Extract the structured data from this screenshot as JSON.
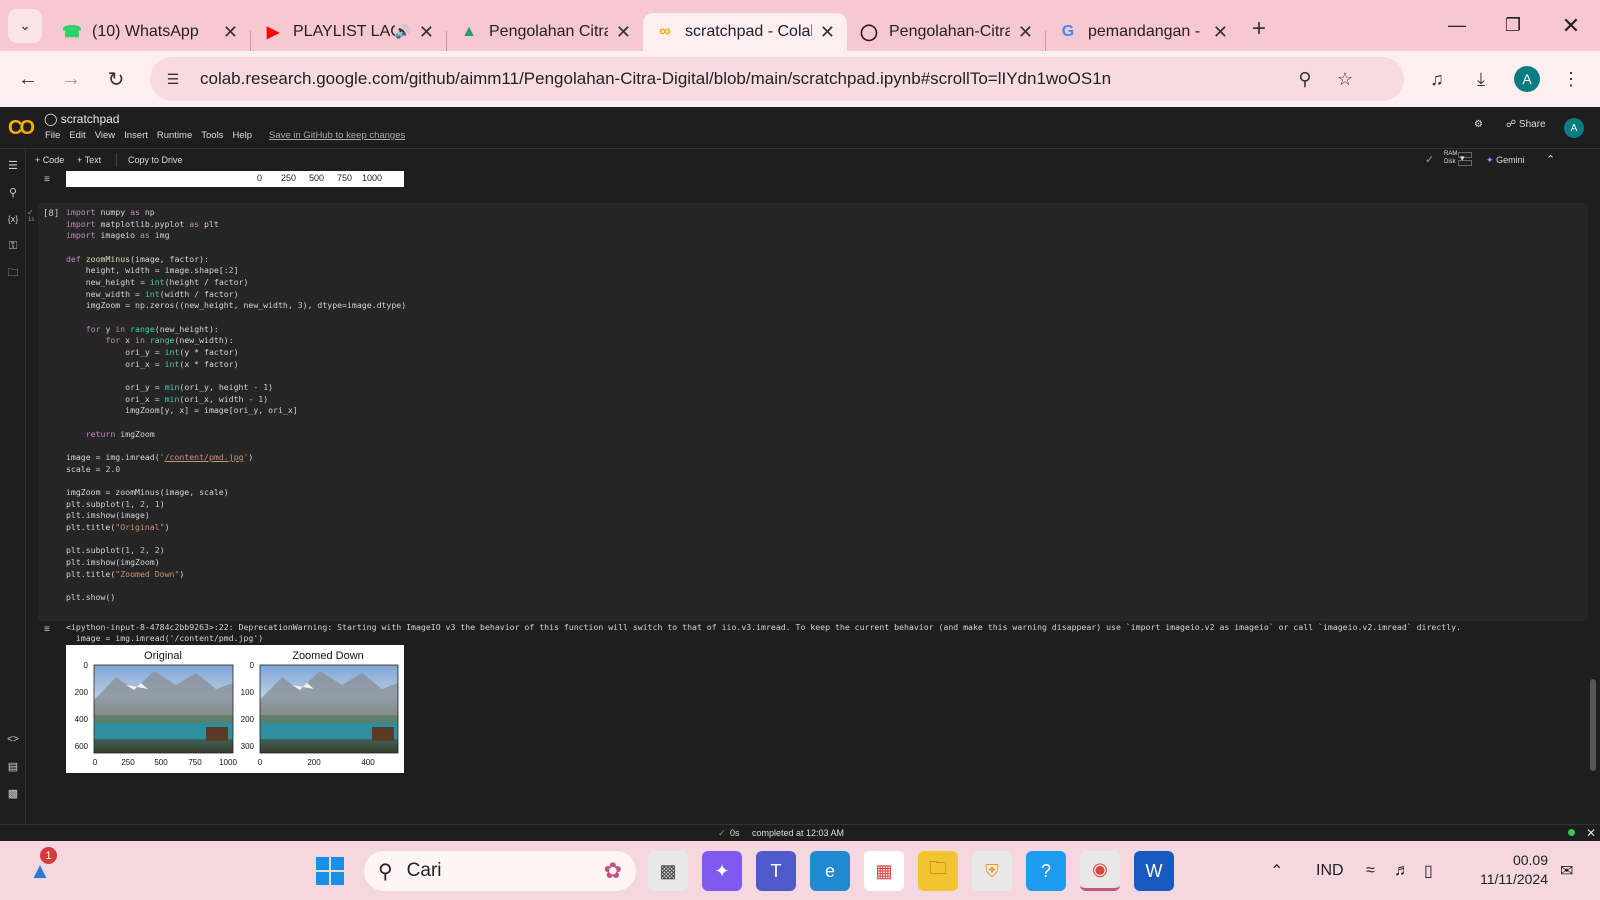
{
  "browser": {
    "tabs": [
      {
        "label": "(10) WhatsApp",
        "icon": "whatsapp-icon",
        "active": false
      },
      {
        "label": "PLAYLIST LAGU",
        "icon": "youtube-icon",
        "active": false,
        "audio": true
      },
      {
        "label": "Pengolahan Citra D",
        "icon": "google-drive-icon",
        "active": false
      },
      {
        "label": "scratchpad - Colab",
        "icon": "colab-icon",
        "active": true
      },
      {
        "label": "Pengolahan-Citra-D",
        "icon": "github-icon",
        "active": false
      },
      {
        "label": "pemandangan - Pe",
        "icon": "google-icon",
        "active": false
      }
    ],
    "url": "colab.research.google.com/github/aimm11/Pengolahan-Citra-Digital/blob/main/scratchpad.ipynb#scrollTo=lIYdn1woOS1n",
    "avatar_letter": "A"
  },
  "colab": {
    "notebook_title": "scratchpad",
    "menu": [
      "File",
      "Edit",
      "View",
      "Insert",
      "Runtime",
      "Tools",
      "Help"
    ],
    "save_github": "Save in GitHub to keep changes",
    "share_label": "Share",
    "avatar_letter": "A",
    "toolbar": {
      "code": "+ Code",
      "text": "+ Text",
      "copy_drive": "Copy to Drive",
      "ram": "RAM",
      "disk": "Disk",
      "gemini": "Gemini"
    },
    "prev_output_ticks": [
      "0",
      "250",
      "500",
      "750",
      "1000"
    ],
    "cell": {
      "exec_count": "[8]",
      "code": [
        "import numpy as np",
        "import matplotlib.pyplot as plt",
        "import imageio as img",
        "",
        "def zoomMinus(image, factor):",
        "    height, width = image.shape[:2]",
        "    new_height = int(height / factor)",
        "    new_width = int(width / factor)",
        "    imgZoom = np.zeros((new_height, new_width, 3), dtype=image.dtype)",
        "",
        "    for y in range(new_height):",
        "        for x in range(new_width):",
        "            ori_y = int(y * factor)",
        "            ori_x = int(x * factor)",
        "",
        "            ori_y = min(ori_y, height - 1)",
        "            ori_x = min(ori_x, width - 1)",
        "            imgZoom[y, x] = image[ori_y, ori_x]",
        "",
        "    return imgZoom",
        "",
        "image = img.imread('/content/pmd.jpg')",
        "scale = 2.0",
        "",
        "imgZoom = zoomMinus(image, scale)",
        "plt.subplot(1, 2, 1)",
        "plt.imshow(image)",
        "plt.title(\"Original\")",
        "",
        "plt.subplot(1, 2, 2)",
        "plt.imshow(imgZoom)",
        "plt.title(\"Zoomed Down\")",
        "",
        "plt.show()"
      ]
    },
    "warning_line1": "<ipython-input-8-4784c2bb9263>:22: DeprecationWarning: Starting with ImageIO v3 the behavior of this function will switch to that of iio.v3.imread. To keep the current behavior (and make this warning disappear) use `import imageio.v2 as imageio` or call `imageio.v2.imread` directly.",
    "warning_line2": "  image = img.imread('/content/pmd.jpg')",
    "figure": {
      "left": {
        "title": "Original",
        "yticks": [
          "0",
          "200",
          "400",
          "600"
        ],
        "xticks": [
          "0",
          "250",
          "500",
          "750",
          "1000"
        ]
      },
      "right": {
        "title": "Zoomed Down",
        "yticks": [
          "0",
          "100",
          "200",
          "300"
        ],
        "xticks": [
          "0",
          "200",
          "400"
        ]
      }
    },
    "status": {
      "time": "0s",
      "text": "completed at 12:03 AM"
    }
  },
  "taskbar": {
    "notification_count": "1",
    "search_placeholder": "Cari",
    "lang": "IND",
    "time": "00.09",
    "date": "11/11/2024"
  }
}
